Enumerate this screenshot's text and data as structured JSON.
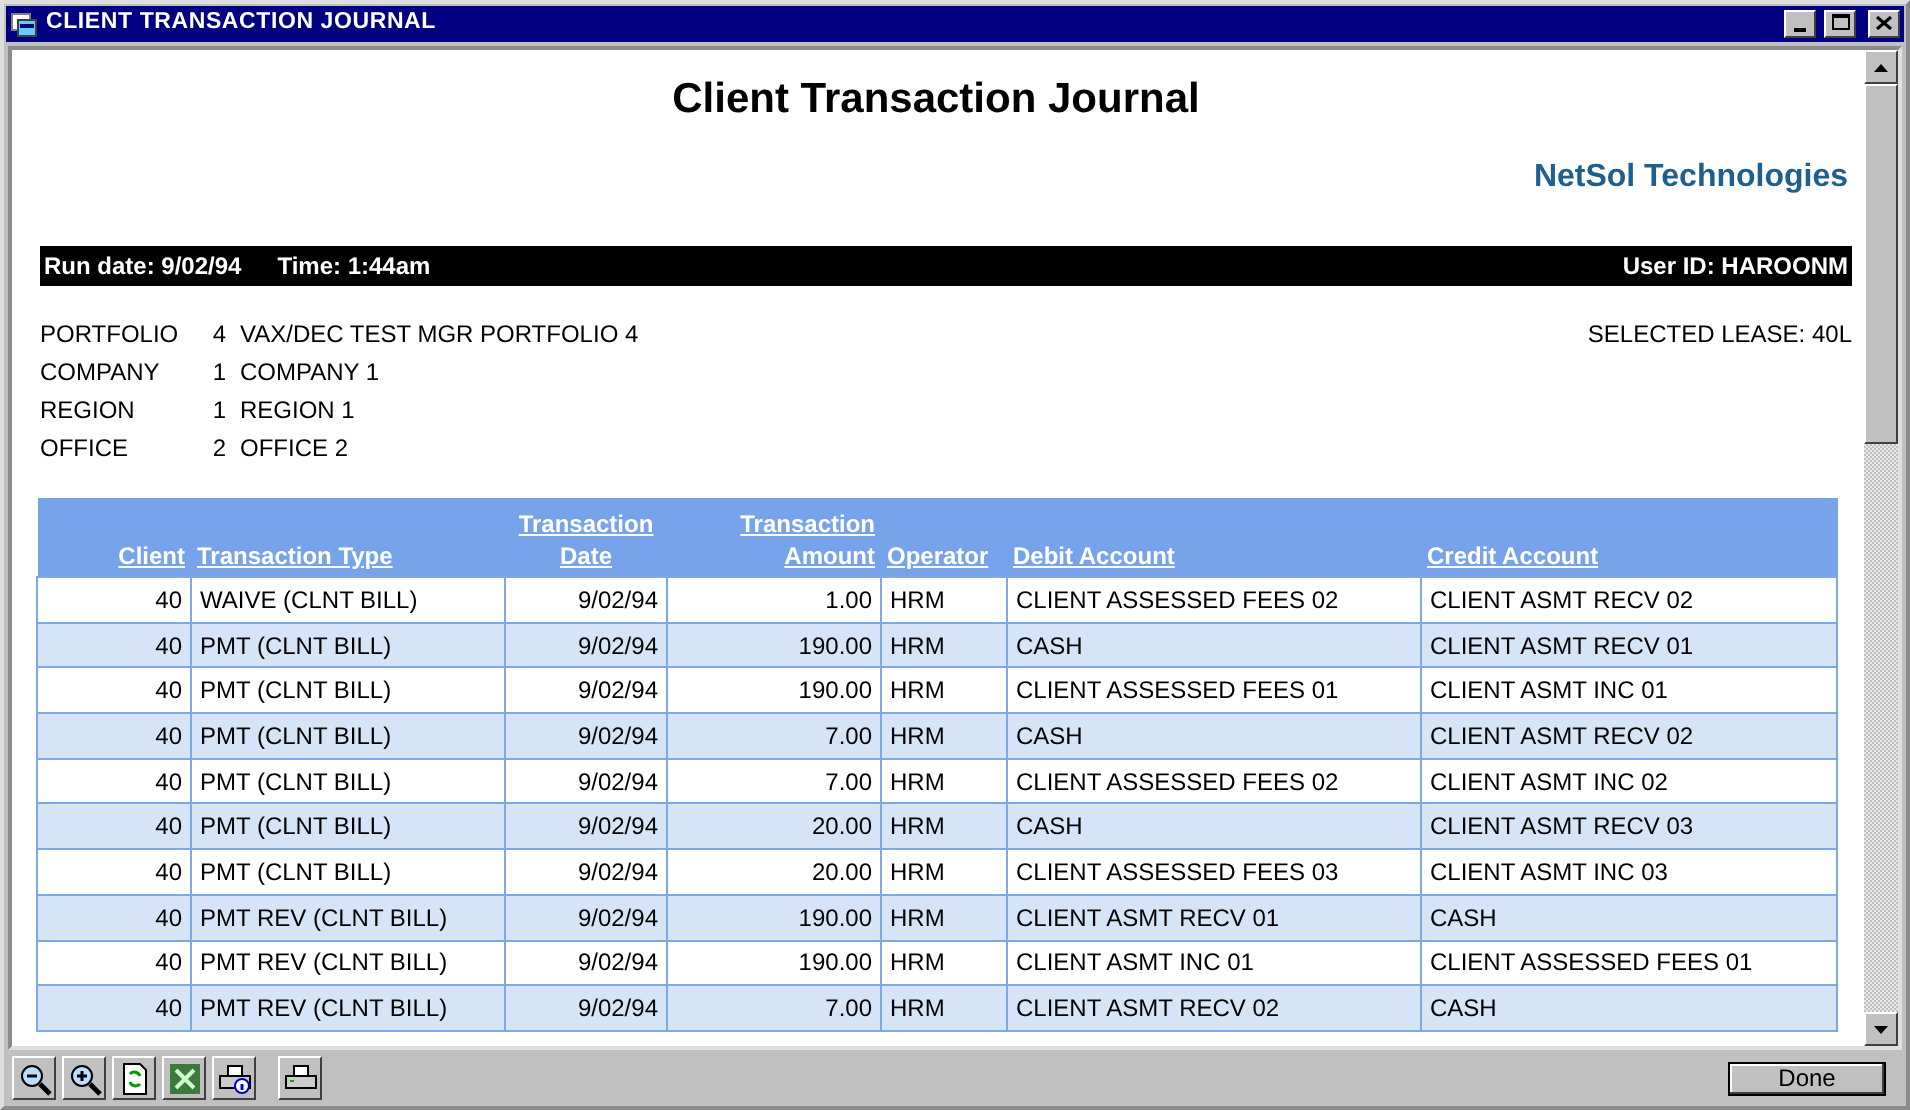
{
  "window": {
    "title": "CLIENT TRANSACTION JOURNAL"
  },
  "report": {
    "title": "Client Transaction Journal",
    "company": "NetSol Technologies",
    "run_date": "Run date: 9/02/94",
    "time": "Time: 1:44am",
    "user_id": "User ID: HAROONM",
    "selected_lease": "SELECTED LEASE: 40L"
  },
  "filters": [
    {
      "label": "PORTFOLIO",
      "code": "4",
      "name": "VAX/DEC TEST MGR PORTFOLIO 4"
    },
    {
      "label": "COMPANY",
      "code": "1",
      "name": "COMPANY 1"
    },
    {
      "label": "REGION",
      "code": "1",
      "name": "REGION 1"
    },
    {
      "label": "OFFICE",
      "code": "2",
      "name": "OFFICE 2"
    }
  ],
  "table": {
    "columns": [
      "Client",
      "Transaction Type",
      "Transaction Date",
      "Transaction Amount",
      "Operator",
      "Debit Account",
      "Credit Account"
    ],
    "rows": [
      [
        "40",
        "WAIVE (CLNT BILL)",
        "9/02/94",
        "1.00",
        "HRM",
        "CLIENT ASSESSED FEES 02",
        "CLIENT ASMT RECV 02"
      ],
      [
        "40",
        "PMT (CLNT BILL)",
        "9/02/94",
        "190.00",
        "HRM",
        "CASH",
        "CLIENT ASMT RECV 01"
      ],
      [
        "40",
        "PMT (CLNT BILL)",
        "9/02/94",
        "190.00",
        "HRM",
        "CLIENT ASSESSED FEES 01",
        "CLIENT ASMT INC 01"
      ],
      [
        "40",
        "PMT (CLNT BILL)",
        "9/02/94",
        "7.00",
        "HRM",
        "CASH",
        "CLIENT ASMT RECV 02"
      ],
      [
        "40",
        "PMT (CLNT BILL)",
        "9/02/94",
        "7.00",
        "HRM",
        "CLIENT ASSESSED FEES 02",
        "CLIENT ASMT INC 02"
      ],
      [
        "40",
        "PMT (CLNT BILL)",
        "9/02/94",
        "20.00",
        "HRM",
        "CASH",
        "CLIENT ASMT RECV 03"
      ],
      [
        "40",
        "PMT (CLNT BILL)",
        "9/02/94",
        "20.00",
        "HRM",
        "CLIENT ASSESSED FEES 03",
        "CLIENT ASMT INC 03"
      ],
      [
        "40",
        "PMT REV (CLNT BILL)",
        "9/02/94",
        "190.00",
        "HRM",
        "CLIENT ASMT RECV 01",
        "CASH"
      ],
      [
        "40",
        "PMT REV (CLNT BILL)",
        "9/02/94",
        "190.00",
        "HRM",
        "CLIENT ASMT INC 01",
        "CLIENT ASSESSED FEES 01"
      ],
      [
        "40",
        "PMT REV (CLNT BILL)",
        "9/02/94",
        "7.00",
        "HRM",
        "CLIENT ASMT RECV 02",
        "CASH"
      ]
    ]
  },
  "done_button": "Done"
}
